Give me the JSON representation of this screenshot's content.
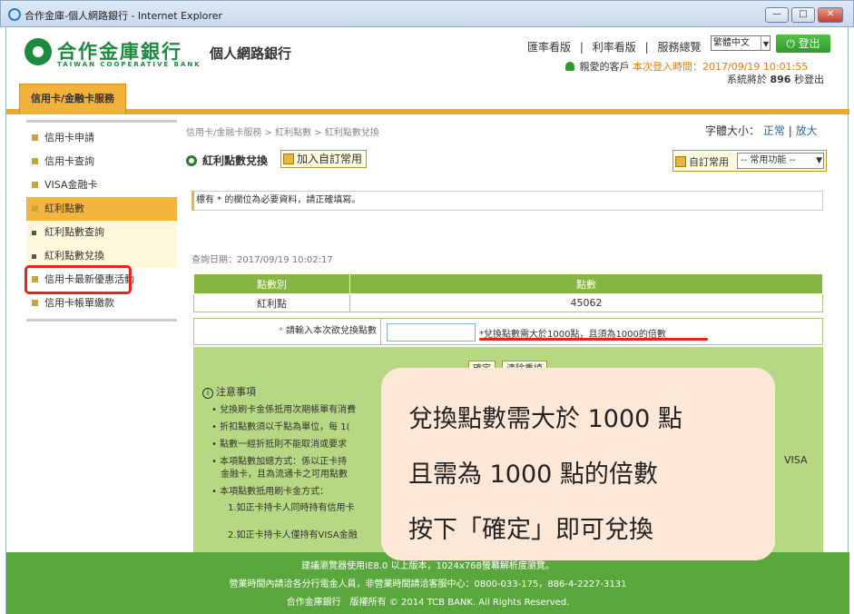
{
  "window": {
    "title": "合作金庫-個人網路銀行 - Internet Explorer",
    "btn_min": "—",
    "btn_max": "□",
    "btn_close": "✕"
  },
  "brand": {
    "name_zh": "合作金庫銀行",
    "name_en": "TAIWAN COOPERATIVE BANK",
    "site_title": "個人網路銀行"
  },
  "toplinks": {
    "exchange": "匯率看版",
    "interest": "利率看版",
    "services": "服務總覽",
    "sep": "|"
  },
  "language": {
    "selected": "繁體中文"
  },
  "logout": {
    "label": "⏻ 登出"
  },
  "user": {
    "greeting": "親愛的客戶",
    "login_time_label": "本次登入時間：2017/09/19 10:01:55",
    "timer_prefix": "系統將於",
    "timer_seconds": "896",
    "timer_suffix": "秒登出"
  },
  "main_tab": {
    "label": "信用卡/金融卡服務"
  },
  "sidebar": {
    "items": [
      {
        "label": "信用卡申請"
      },
      {
        "label": "信用卡查詢"
      },
      {
        "label": "VISA金融卡"
      },
      {
        "label": "紅利點數"
      },
      {
        "label": "紅利點數查詢"
      },
      {
        "label": "紅利點數兌換"
      },
      {
        "label": "信用卡最新優惠活動"
      },
      {
        "label": "信用卡帳單繳款"
      }
    ]
  },
  "content": {
    "breadcrumb": "信用卡/金融卡服務 > 紅利點數 > 紅利點數兌換",
    "font_size_label": "字體大小：",
    "font_normal": "正常",
    "font_large": "放大",
    "heading": "紅利點數兌換",
    "add_favorite": "加入自訂常用",
    "my_favorite_label": "自訂常用",
    "my_favorite_select": "-- 常用功能 --",
    "required_notice": "標有 * 的欄位為必要資料，請正確填寫。",
    "query_date": "查詢日期：2017/09/19 10:02:17"
  },
  "points_table": {
    "headers": [
      "點數別",
      "點數"
    ],
    "rows": [
      [
        "紅利點",
        "45062"
      ]
    ]
  },
  "input": {
    "label": "請輸入本次欲兌換點數",
    "star": "*",
    "value": "",
    "hint": "*兌換點數需大於1000點，且須為1000的倍數"
  },
  "buttons": {
    "confirm": "確定",
    "clear": "清除重填"
  },
  "notes": {
    "title": "注意事項",
    "items": [
      "兌換刷卡金係抵用次期帳單有消費",
      "折扣點數須以千點為單位，每 1(",
      "點數一經折抵則不能取消或要求",
      "本項點數加總方式：係以正卡持",
      "金融卡，且為流通卡之可用點數",
      "本項點數抵用刷卡金方式：",
      "1.如正卡持卡人同時持有信用卡",
      "2.如正卡持卡人僅持有VISA金融"
    ],
    "visa_tail": "VISA"
  },
  "callout": {
    "line1": "兌換點數需大於 1000 點",
    "line2": "且需為 1000 點的倍數",
    "line3": "按下「確定」即可兌換"
  },
  "footer": {
    "line1": "建議瀏覽器使用IE8.0 以上版本，1024x768螢幕解析度瀏覽。",
    "line2": "營業時間內請洽各分行電金人員，非營業時間請洽客服中心：0800-033-175，886-4-2227-3131",
    "line3": "合作金庫銀行　版權所有 © 2014 TCB BANK. All Rights Reserved."
  }
}
